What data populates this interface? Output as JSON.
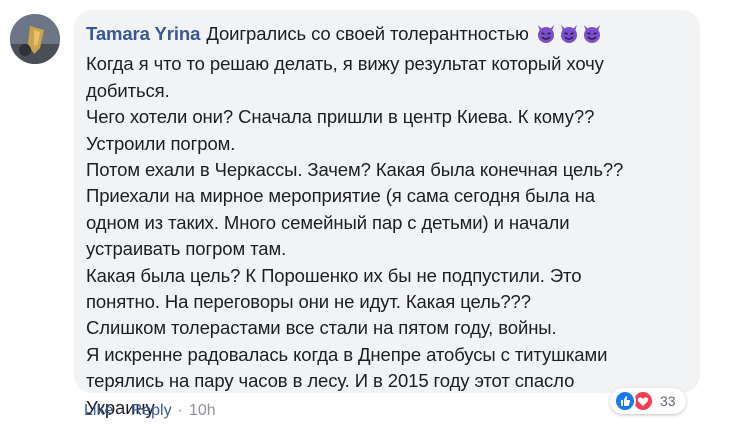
{
  "comment": {
    "author": "Tamara Yrina",
    "lines": [
      "Доигрались со своей толерантностью",
      "Когда я что то решаю делать, я вижу результат который хочу",
      "добиться.",
      "Чего хотели они? Сначала пришли в центр Киева. К кому??",
      "Устроили погром.",
      "Потом ехали в Черкассы. Зачем? Какая была конечная цель??",
      "Приехали на мирное мероприятие (я сама сегодня была на",
      "одном из таких. Много семейный пар с детьми) и начали",
      "устраивать погром там.",
      "Какая была цель? К Порошенко их бы не подпустили. Это",
      "понятно. На переговоры они не идут. Какая цель???",
      "Слишком толерастами все стали на пятом году, войны.",
      "Я искренне радовалась когда в Днепре атобусы с титушками",
      "терялись на пару часов в лесу. И в 2015 году этот спасло",
      "Украину"
    ],
    "emojis": [
      "devil-face-icon",
      "devil-face-icon",
      "devil-face-icon"
    ]
  },
  "actions": {
    "like": "Like",
    "separator": "·",
    "reply": "Reply",
    "time": "10h"
  },
  "reactions": {
    "icons": [
      "like-reaction-icon",
      "love-reaction-icon"
    ],
    "count": "33"
  },
  "colors": {
    "author": "#385898",
    "bubble": "#f2f3f5",
    "text": "#1c1e21",
    "meta": "#90949c",
    "emoji": "#7b4fc9"
  }
}
